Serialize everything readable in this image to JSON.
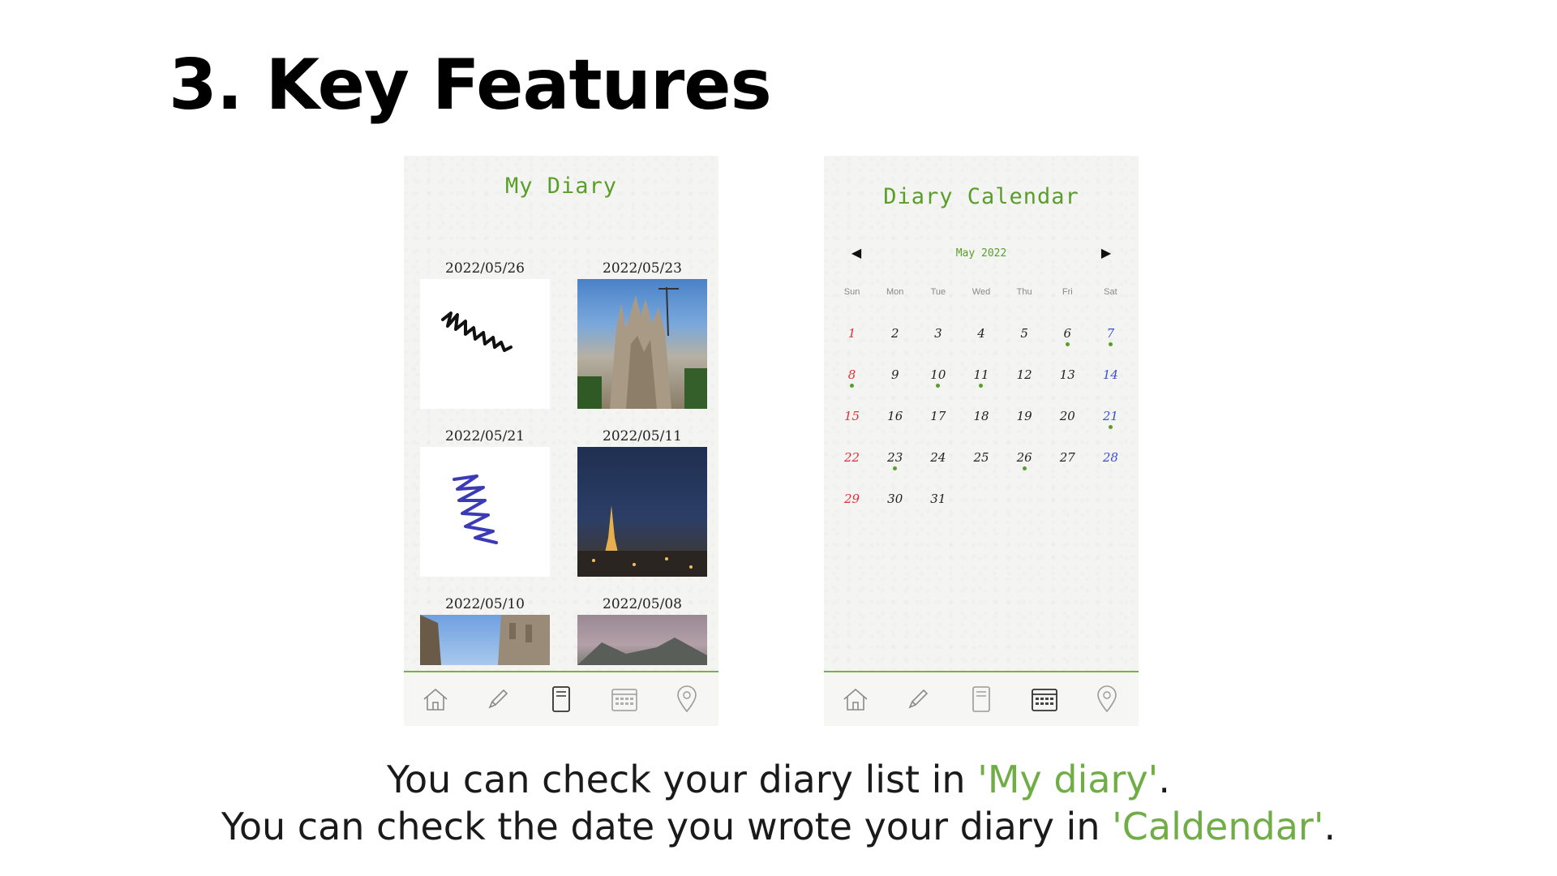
{
  "slide": {
    "title": "3. Key Features",
    "caption": {
      "line1_prefix": "You can check your diary list in ",
      "line1_highlight": "'My diary'",
      "line1_suffix": ".",
      "line2_prefix": "You can check the date you wrote your diary in ",
      "line2_highlight": "'Caldendar'",
      "line2_suffix": "."
    },
    "accent_color": "#70ad47"
  },
  "diary_screen": {
    "title": "My Diary",
    "entries": [
      {
        "date": "2022/05/26",
        "thumb": "black-scribble"
      },
      {
        "date": "2022/05/23",
        "thumb": "cathedral-photo"
      },
      {
        "date": "2022/05/21",
        "thumb": "blue-scribble"
      },
      {
        "date": "2022/05/11",
        "thumb": "eiffel-night-photo"
      },
      {
        "date": "2022/05/10",
        "thumb": "building-sky-photo"
      },
      {
        "date": "2022/05/08",
        "thumb": "mountain-photo"
      }
    ]
  },
  "calendar_screen": {
    "title": "Diary Calendar",
    "month": "May 2022",
    "weekdays": [
      "Sun",
      "Mon",
      "Tue",
      "Wed",
      "Thu",
      "Fri",
      "Sat"
    ],
    "days": [
      {
        "n": "1",
        "dot": false
      },
      {
        "n": "2",
        "dot": false
      },
      {
        "n": "3",
        "dot": false
      },
      {
        "n": "4",
        "dot": false
      },
      {
        "n": "5",
        "dot": false
      },
      {
        "n": "6",
        "dot": true
      },
      {
        "n": "7",
        "dot": true
      },
      {
        "n": "8",
        "dot": true
      },
      {
        "n": "9",
        "dot": false
      },
      {
        "n": "10",
        "dot": true
      },
      {
        "n": "11",
        "dot": true
      },
      {
        "n": "12",
        "dot": false
      },
      {
        "n": "13",
        "dot": false
      },
      {
        "n": "14",
        "dot": false
      },
      {
        "n": "15",
        "dot": false
      },
      {
        "n": "16",
        "dot": false
      },
      {
        "n": "17",
        "dot": false
      },
      {
        "n": "18",
        "dot": false
      },
      {
        "n": "19",
        "dot": false
      },
      {
        "n": "20",
        "dot": false
      },
      {
        "n": "21",
        "dot": true
      },
      {
        "n": "22",
        "dot": false
      },
      {
        "n": "23",
        "dot": true
      },
      {
        "n": "24",
        "dot": false
      },
      {
        "n": "25",
        "dot": false
      },
      {
        "n": "26",
        "dot": true
      },
      {
        "n": "27",
        "dot": false
      },
      {
        "n": "28",
        "dot": false
      },
      {
        "n": "29",
        "dot": false
      },
      {
        "n": "30",
        "dot": false
      },
      {
        "n": "31",
        "dot": false
      }
    ]
  },
  "navbar": {
    "icons": [
      "home-icon",
      "pencil-icon",
      "notebook-icon",
      "calendar-icon",
      "location-pin-icon"
    ]
  }
}
